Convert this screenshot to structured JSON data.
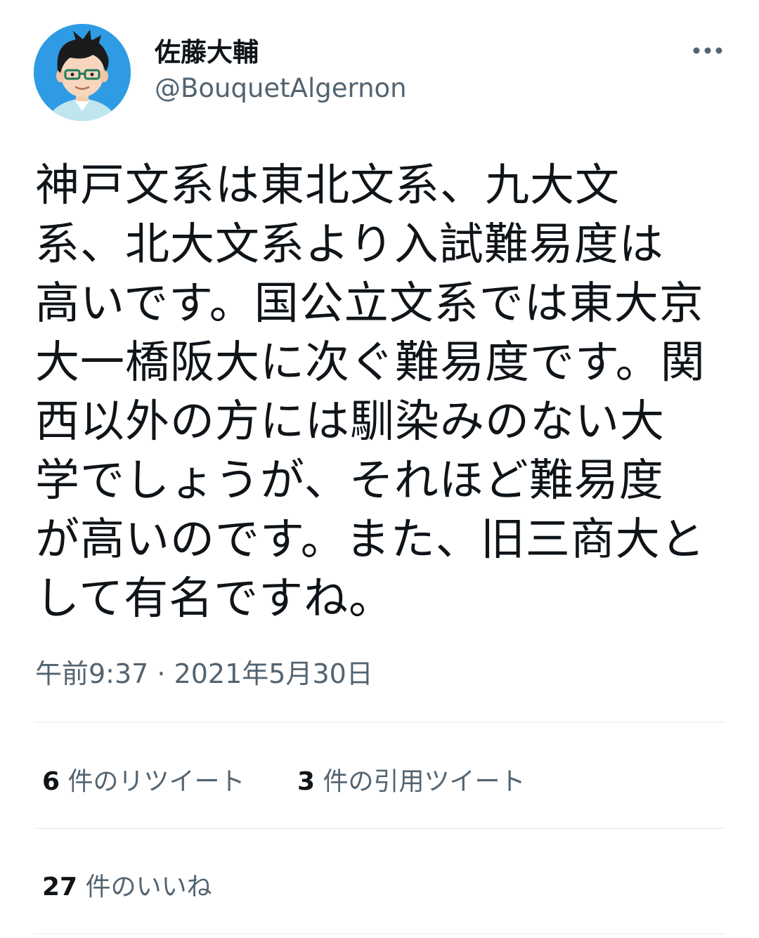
{
  "author": {
    "display_name": "佐藤大輔",
    "handle": "@BouquetAlgernon"
  },
  "tweet": {
    "text": "神戸文系は東北文系、九大文\n系、北大文系より入試難易度は\n高いです。国公立文系では東大京\n大一橋阪大に次ぐ難易度です。関\n西以外の方には馴染みのない大\n学でしょうが、それほど難易度\nが高いのです。また、旧三商大と\nして有名ですね。",
    "timestamp": "午前9:37 · 2021年5月30日"
  },
  "stats": {
    "retweets": {
      "count": "6",
      "label": "件のリツイート"
    },
    "quotes": {
      "count": "3",
      "label": "件の引用ツイート"
    },
    "likes": {
      "count": "27",
      "label": "件のいいね"
    }
  },
  "icons": {
    "avatar": "avatar-illustration",
    "more": "more-horizontal-icon"
  },
  "colors": {
    "text_primary": "#0f1419",
    "text_secondary": "#536471",
    "divider": "#eff3f4",
    "avatar_bg": "#2f9be4"
  }
}
